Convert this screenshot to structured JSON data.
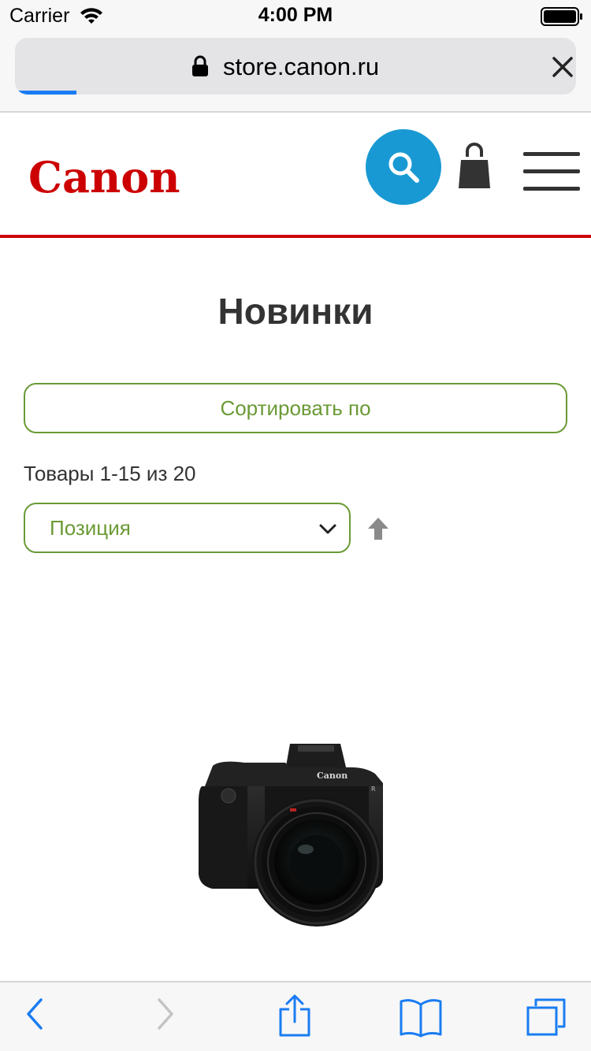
{
  "status_bar": {
    "carrier": "Carrier",
    "time": "4:00 PM",
    "wifi_icon": "wifi-icon",
    "battery_icon": "battery-full-icon"
  },
  "browser": {
    "url": "store.canon.ru",
    "lock_icon": "lock-icon",
    "close_icon": "close-icon",
    "load_progress": 0.11,
    "accent_color": "#1a7cf2"
  },
  "header": {
    "logo_text": "Canon",
    "logo_color": "#cc0000",
    "search_icon": "search-icon",
    "search_color": "#1999d3",
    "cart_icon": "shopping-bag-icon",
    "menu_icon": "hamburger-menu-icon",
    "divider_color": "#cc0000"
  },
  "main": {
    "title": "Новинки",
    "sort_button_label": "Сортировать по",
    "items_count": "Товары 1-15 из 20",
    "sort_select": {
      "selected": "Позиция",
      "chevron_icon": "chevron-down-icon"
    },
    "sort_direction_icon": "arrow-up-icon",
    "accent_color": "#6a9a35",
    "product_image": {
      "brand_text": "Canon",
      "model_text": "EOS R"
    }
  },
  "toolbar": {
    "back_icon": "back-chevron-icon",
    "forward_icon": "forward-chevron-icon",
    "share_icon": "share-icon",
    "bookmarks_icon": "bookmarks-icon",
    "tabs_icon": "tabs-icon"
  }
}
